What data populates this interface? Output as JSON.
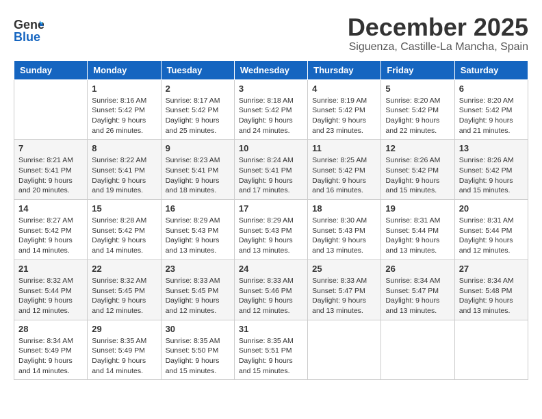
{
  "header": {
    "logo_general": "General",
    "logo_blue": "Blue",
    "title": "December 2025",
    "subtitle": "Siguenza, Castille-La Mancha, Spain"
  },
  "columns": [
    "Sunday",
    "Monday",
    "Tuesday",
    "Wednesday",
    "Thursday",
    "Friday",
    "Saturday"
  ],
  "weeks": [
    [
      {
        "num": "",
        "info": ""
      },
      {
        "num": "1",
        "info": "Sunrise: 8:16 AM\nSunset: 5:42 PM\nDaylight: 9 hours\nand 26 minutes."
      },
      {
        "num": "2",
        "info": "Sunrise: 8:17 AM\nSunset: 5:42 PM\nDaylight: 9 hours\nand 25 minutes."
      },
      {
        "num": "3",
        "info": "Sunrise: 8:18 AM\nSunset: 5:42 PM\nDaylight: 9 hours\nand 24 minutes."
      },
      {
        "num": "4",
        "info": "Sunrise: 8:19 AM\nSunset: 5:42 PM\nDaylight: 9 hours\nand 23 minutes."
      },
      {
        "num": "5",
        "info": "Sunrise: 8:20 AM\nSunset: 5:42 PM\nDaylight: 9 hours\nand 22 minutes."
      },
      {
        "num": "6",
        "info": "Sunrise: 8:20 AM\nSunset: 5:42 PM\nDaylight: 9 hours\nand 21 minutes."
      }
    ],
    [
      {
        "num": "7",
        "info": "Sunrise: 8:21 AM\nSunset: 5:41 PM\nDaylight: 9 hours\nand 20 minutes."
      },
      {
        "num": "8",
        "info": "Sunrise: 8:22 AM\nSunset: 5:41 PM\nDaylight: 9 hours\nand 19 minutes."
      },
      {
        "num": "9",
        "info": "Sunrise: 8:23 AM\nSunset: 5:41 PM\nDaylight: 9 hours\nand 18 minutes."
      },
      {
        "num": "10",
        "info": "Sunrise: 8:24 AM\nSunset: 5:41 PM\nDaylight: 9 hours\nand 17 minutes."
      },
      {
        "num": "11",
        "info": "Sunrise: 8:25 AM\nSunset: 5:42 PM\nDaylight: 9 hours\nand 16 minutes."
      },
      {
        "num": "12",
        "info": "Sunrise: 8:26 AM\nSunset: 5:42 PM\nDaylight: 9 hours\nand 15 minutes."
      },
      {
        "num": "13",
        "info": "Sunrise: 8:26 AM\nSunset: 5:42 PM\nDaylight: 9 hours\nand 15 minutes."
      }
    ],
    [
      {
        "num": "14",
        "info": "Sunrise: 8:27 AM\nSunset: 5:42 PM\nDaylight: 9 hours\nand 14 minutes."
      },
      {
        "num": "15",
        "info": "Sunrise: 8:28 AM\nSunset: 5:42 PM\nDaylight: 9 hours\nand 14 minutes."
      },
      {
        "num": "16",
        "info": "Sunrise: 8:29 AM\nSunset: 5:43 PM\nDaylight: 9 hours\nand 13 minutes."
      },
      {
        "num": "17",
        "info": "Sunrise: 8:29 AM\nSunset: 5:43 PM\nDaylight: 9 hours\nand 13 minutes."
      },
      {
        "num": "18",
        "info": "Sunrise: 8:30 AM\nSunset: 5:43 PM\nDaylight: 9 hours\nand 13 minutes."
      },
      {
        "num": "19",
        "info": "Sunrise: 8:31 AM\nSunset: 5:44 PM\nDaylight: 9 hours\nand 13 minutes."
      },
      {
        "num": "20",
        "info": "Sunrise: 8:31 AM\nSunset: 5:44 PM\nDaylight: 9 hours\nand 12 minutes."
      }
    ],
    [
      {
        "num": "21",
        "info": "Sunrise: 8:32 AM\nSunset: 5:44 PM\nDaylight: 9 hours\nand 12 minutes."
      },
      {
        "num": "22",
        "info": "Sunrise: 8:32 AM\nSunset: 5:45 PM\nDaylight: 9 hours\nand 12 minutes."
      },
      {
        "num": "23",
        "info": "Sunrise: 8:33 AM\nSunset: 5:45 PM\nDaylight: 9 hours\nand 12 minutes."
      },
      {
        "num": "24",
        "info": "Sunrise: 8:33 AM\nSunset: 5:46 PM\nDaylight: 9 hours\nand 12 minutes."
      },
      {
        "num": "25",
        "info": "Sunrise: 8:33 AM\nSunset: 5:47 PM\nDaylight: 9 hours\nand 13 minutes."
      },
      {
        "num": "26",
        "info": "Sunrise: 8:34 AM\nSunset: 5:47 PM\nDaylight: 9 hours\nand 13 minutes."
      },
      {
        "num": "27",
        "info": "Sunrise: 8:34 AM\nSunset: 5:48 PM\nDaylight: 9 hours\nand 13 minutes."
      }
    ],
    [
      {
        "num": "28",
        "info": "Sunrise: 8:34 AM\nSunset: 5:49 PM\nDaylight: 9 hours\nand 14 minutes."
      },
      {
        "num": "29",
        "info": "Sunrise: 8:35 AM\nSunset: 5:49 PM\nDaylight: 9 hours\nand 14 minutes."
      },
      {
        "num": "30",
        "info": "Sunrise: 8:35 AM\nSunset: 5:50 PM\nDaylight: 9 hours\nand 15 minutes."
      },
      {
        "num": "31",
        "info": "Sunrise: 8:35 AM\nSunset: 5:51 PM\nDaylight: 9 hours\nand 15 minutes."
      },
      {
        "num": "",
        "info": ""
      },
      {
        "num": "",
        "info": ""
      },
      {
        "num": "",
        "info": ""
      }
    ]
  ]
}
